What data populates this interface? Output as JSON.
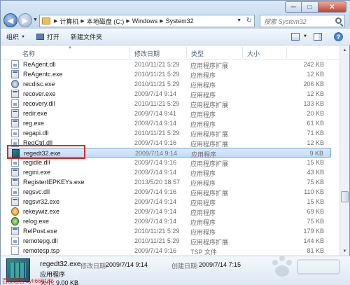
{
  "window": {
    "controls": {
      "minimize": "─",
      "maximize": "□",
      "close": "✕"
    }
  },
  "nav": {
    "back_icon": "arrow-left-icon",
    "forward_icon": "arrow-right-icon"
  },
  "address": {
    "crumbs": [
      "计算机",
      "本地磁盘 (C:)",
      "Windows",
      "System32"
    ]
  },
  "search": {
    "placeholder": "搜索 System32"
  },
  "toolbar": {
    "organize_label": "组织",
    "open_label": "打开",
    "new_folder_label": "新建文件夹"
  },
  "columns": {
    "name": "名称",
    "date": "修改日期",
    "type": "类型",
    "size": "大小"
  },
  "files": [
    {
      "name": "ReAgent.dll",
      "date": "2010/11/21 5:29",
      "type": "应用程序扩展",
      "size": "242 KB",
      "icon": "dll"
    },
    {
      "name": "ReAgentc.exe",
      "date": "2010/11/21 5:29",
      "type": "应用程序",
      "size": "12 KB",
      "icon": "exe"
    },
    {
      "name": "recdisc.exe",
      "date": "2010/11/21 5:29",
      "type": "应用程序",
      "size": "206 KB",
      "icon": "recdisc"
    },
    {
      "name": "recover.exe",
      "date": "2009/7/14 9:14",
      "type": "应用程序",
      "size": "12 KB",
      "icon": "exe"
    },
    {
      "name": "recovery.dll",
      "date": "2010/11/21 5:29",
      "type": "应用程序扩展",
      "size": "133 KB",
      "icon": "dll"
    },
    {
      "name": "redir.exe",
      "date": "2009/7/14 9:41",
      "type": "应用程序",
      "size": "20 KB",
      "icon": "exe"
    },
    {
      "name": "reg.exe",
      "date": "2009/7/14 9:14",
      "type": "应用程序",
      "size": "61 KB",
      "icon": "exe"
    },
    {
      "name": "regapi.dll",
      "date": "2010/11/21 5:29",
      "type": "应用程序扩展",
      "size": "71 KB",
      "icon": "dll"
    },
    {
      "name": "RegCtrl.dll",
      "date": "2009/7/14 9:16",
      "type": "应用程序扩展",
      "size": "12 KB",
      "icon": "dll"
    },
    {
      "name": "regedt32.exe",
      "date": "2009/7/14 9:14",
      "type": "应用程序",
      "size": "9 KB",
      "icon": "regedit",
      "selected": true
    },
    {
      "name": "regidle.dll",
      "date": "2009/7/14 9:16",
      "type": "应用程序扩展",
      "size": "15 KB",
      "icon": "dll"
    },
    {
      "name": "regini.exe",
      "date": "2009/7/14 9:14",
      "type": "应用程序",
      "size": "43 KB",
      "icon": "exe"
    },
    {
      "name": "RegisterIEPKEYs.exe",
      "date": "2013/5/20 18:57",
      "type": "应用程序",
      "size": "75 KB",
      "icon": "exe"
    },
    {
      "name": "regsvc.dll",
      "date": "2009/7/14 9:16",
      "type": "应用程序扩展",
      "size": "110 KB",
      "icon": "dll"
    },
    {
      "name": "regsvr32.exe",
      "date": "2009/7/14 9:14",
      "type": "应用程序",
      "size": "15 KB",
      "icon": "exe"
    },
    {
      "name": "rekeywiz.exe",
      "date": "2009/7/14 9:14",
      "type": "应用程序",
      "size": "69 KB",
      "icon": "wiz"
    },
    {
      "name": "relog.exe",
      "date": "2009/7/14 9:14",
      "type": "应用程序",
      "size": "75 KB",
      "icon": "relog"
    },
    {
      "name": "RelPost.exe",
      "date": "2010/11/21 5:29",
      "type": "应用程序",
      "size": "179 KB",
      "icon": "exe"
    },
    {
      "name": "remotepg.dll",
      "date": "2010/11/21 5:29",
      "type": "应用程序扩展",
      "size": "144 KB",
      "icon": "dll"
    },
    {
      "name": "remotesp.tsp",
      "date": "2009/7/14 9:16",
      "type": "TSP 文件",
      "size": "81 KB",
      "icon": "tsp"
    }
  ],
  "details": {
    "name": "regedt32.exe",
    "modified_label": "修改日期:",
    "modified_value": "2009/7/14 9:14",
    "created_label": "创建日期:",
    "created_value": "2009/7/14 7:15",
    "type": "应用程序",
    "size": "大小: 9.00 KB"
  },
  "watermark": {
    "text": "百度经验",
    "footer": "百度经验 zyh666168"
  },
  "colors": {
    "highlight_box": "#e0281c",
    "selection": "#c1dbfc"
  }
}
